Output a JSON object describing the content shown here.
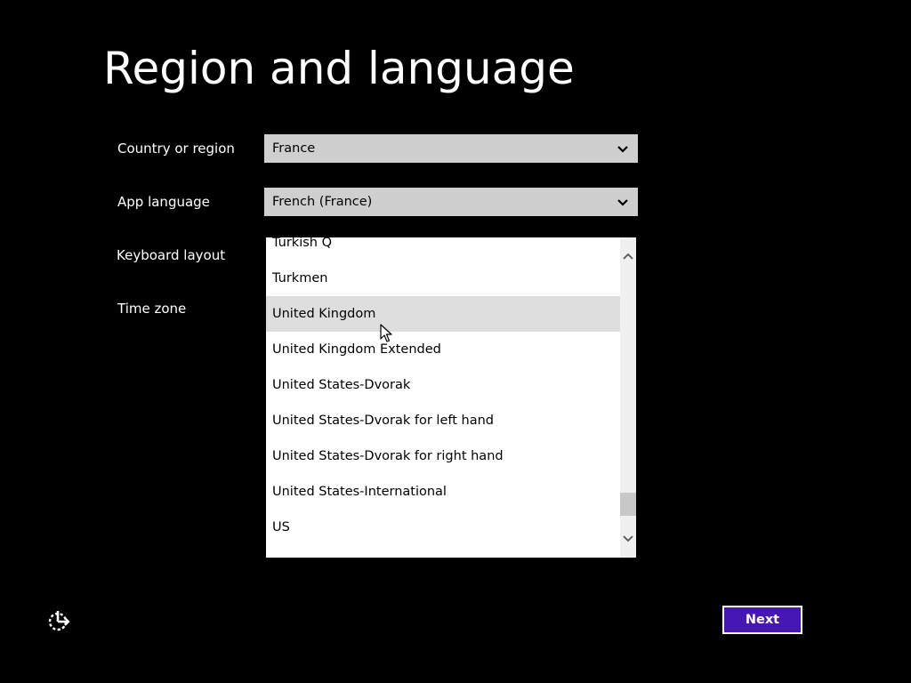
{
  "title": "Region and language",
  "fields": {
    "country": {
      "label": "Country or region",
      "value": "France"
    },
    "app_language": {
      "label": "App language",
      "value": "French (France)"
    },
    "keyboard": {
      "label": "Keyboard layout"
    },
    "timezone": {
      "label": "Time zone"
    }
  },
  "keyboard_list": {
    "items": [
      "Turkish Q",
      "Turkmen",
      "United Kingdom",
      "United Kingdom Extended",
      "United States-Dvorak",
      "United States-Dvorak for left hand",
      "United States-Dvorak for right hand",
      "United States-International",
      "US"
    ],
    "hovered": "United Kingdom"
  },
  "buttons": {
    "next": "Next"
  },
  "icons": {
    "select_arrow": "chevron-down-icon",
    "scroll_up": "chevron-up-icon",
    "scroll_down": "chevron-down-icon",
    "ease_of_access": "ease-of-access-icon",
    "cursor": "mouse-pointer-icon"
  },
  "colors": {
    "background": "#000000",
    "accent": "#4617b4",
    "select_bg": "#cfcfcf",
    "hover_bg": "#dedede"
  }
}
